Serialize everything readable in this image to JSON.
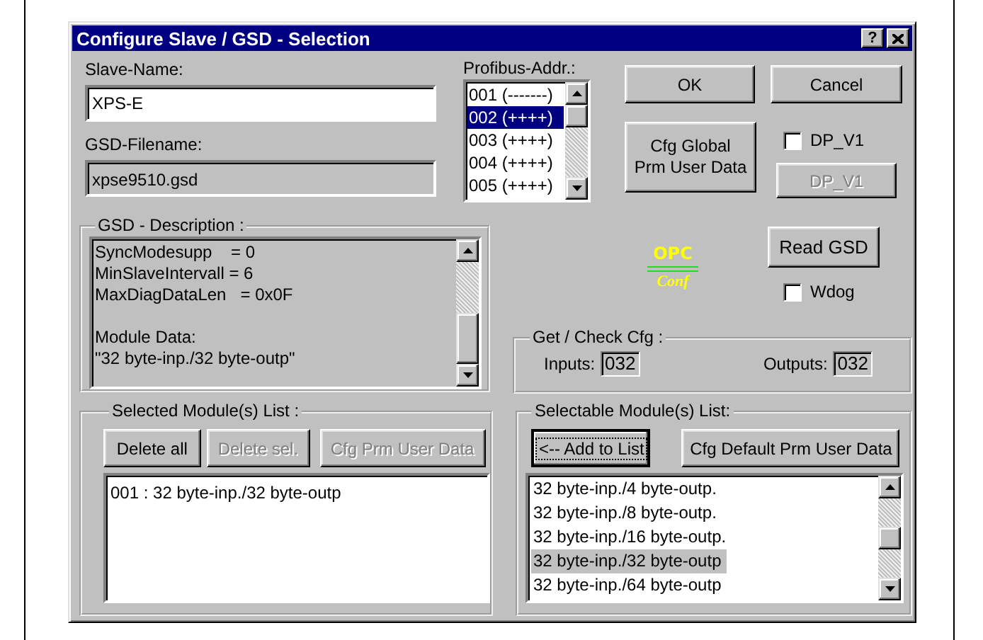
{
  "window": {
    "title": "Configure Slave / GSD - Selection",
    "help_button": "?"
  },
  "slave_name": {
    "label": "Slave-Name:",
    "value": "XPS-E"
  },
  "gsd_filename": {
    "label": "GSD-Filename:",
    "value": "xpse9510.gsd"
  },
  "profibus_addr": {
    "label": "Profibus-Addr.:",
    "items": [
      {
        "text": "001 (-------)",
        "selected": false
      },
      {
        "text": "002 (++++)",
        "selected": true
      },
      {
        "text": "003 (++++)",
        "selected": false
      },
      {
        "text": "004 (++++)",
        "selected": false
      },
      {
        "text": "005 (++++)",
        "selected": false
      }
    ]
  },
  "ok_button": "OK",
  "cancel_button": "Cancel",
  "cfg_global_button": [
    "Cfg Global",
    "Prm User Data"
  ],
  "dp_v1_checkbox": {
    "label": "DP_V1",
    "checked": false
  },
  "dp_v1_button": {
    "label": "DP_V1",
    "disabled": true
  },
  "gsd_description": {
    "title": "GSD - Description :",
    "blocks": [
      [
        "SyncModesupp    = 0",
        "MinSlaveIntervall = 6",
        "MaxDiagDataLen   = 0x0F"
      ],
      [
        "Module Data:",
        "\"32 byte-inp./32 byte-outp\""
      ]
    ]
  },
  "logo": {
    "top": "OPC",
    "bottom": "Conf"
  },
  "read_gsd_button": "Read GSD",
  "wdog_checkbox": {
    "label": "Wdog",
    "checked": false
  },
  "get_check_cfg": {
    "title": "Get / Check Cfg :",
    "inputs": {
      "label": "Inputs:",
      "value": "032"
    },
    "outputs": {
      "label": "Outputs:",
      "value": "032"
    }
  },
  "selected_modules": {
    "title": "Selected Module(s) List :",
    "buttons": [
      {
        "label": "Delete all",
        "disabled": false,
        "default": false
      },
      {
        "label": "Delete sel.",
        "disabled": true,
        "default": false
      },
      {
        "label": "Cfg Prm User Data",
        "disabled": true,
        "default": false
      }
    ],
    "items": [
      {
        "text": "001 : 32 byte-inp./32 byte-outp",
        "selected": false
      }
    ]
  },
  "selectable_modules": {
    "title": "Selectable Module(s) List:",
    "buttons": [
      {
        "label": "<-- Add to List",
        "disabled": false,
        "default": true
      },
      {
        "label": "Cfg Default Prm User Data",
        "disabled": false,
        "default": false
      }
    ],
    "items": [
      {
        "text": "32 byte-inp./4 byte-outp.",
        "selected": false
      },
      {
        "text": "32 byte-inp./8 byte-outp.",
        "selected": false
      },
      {
        "text": "32 byte-inp./16 byte-outp.",
        "selected": false
      },
      {
        "text": "32 byte-inp./32 byte-outp",
        "selected": true
      },
      {
        "text": "32 byte-inp./64 byte-outp",
        "selected": false
      }
    ]
  }
}
